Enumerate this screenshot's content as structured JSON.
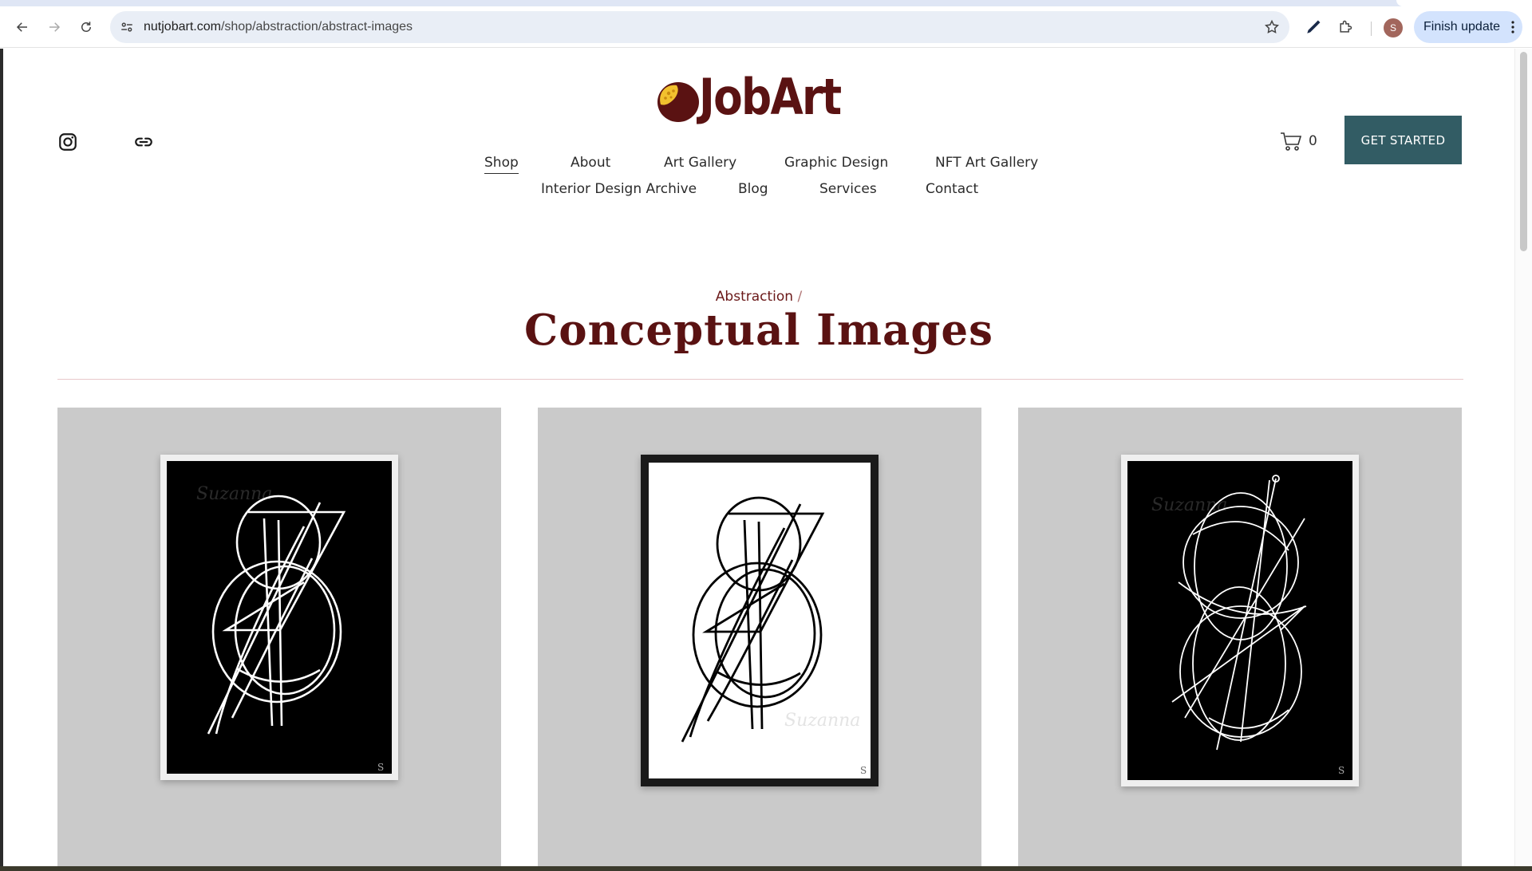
{
  "browser": {
    "url_domain": "nutjobart.com",
    "url_path": "/shop/abstraction/abstract-images",
    "profile_initial": "S",
    "finish_update_label": "Finish update"
  },
  "site": {
    "logo_text": "JobArt",
    "social": [
      "instagram-icon",
      "link-icon"
    ],
    "nav": [
      {
        "label": "Shop",
        "active": true
      },
      {
        "label": "About"
      },
      {
        "label": "Art Gallery"
      },
      {
        "label": "Graphic Design"
      },
      {
        "label": "NFT Art Gallery"
      },
      {
        "label": "Interior Design Archive"
      },
      {
        "label": "Blog"
      },
      {
        "label": "Services"
      },
      {
        "label": "Contact"
      }
    ],
    "cart_count": "0",
    "cta_label": "GET STARTED",
    "colors": {
      "brand": "#5a1212",
      "cta": "#325c64",
      "card_bg": "#cacaca",
      "logo_accent": "#f2c12e"
    }
  },
  "page": {
    "breadcrumb": "Abstraction",
    "breadcrumb_separator": "/",
    "title": "Conceptual Images"
  },
  "products": [
    {
      "frame": "white",
      "art": "white-lines-on-black",
      "signature": "Suzanna"
    },
    {
      "frame": "black",
      "art": "black-lines-on-white",
      "signature": "Suzanna"
    },
    {
      "frame": "white",
      "art": "white-lines-on-black",
      "signature": "Suzanna"
    }
  ]
}
